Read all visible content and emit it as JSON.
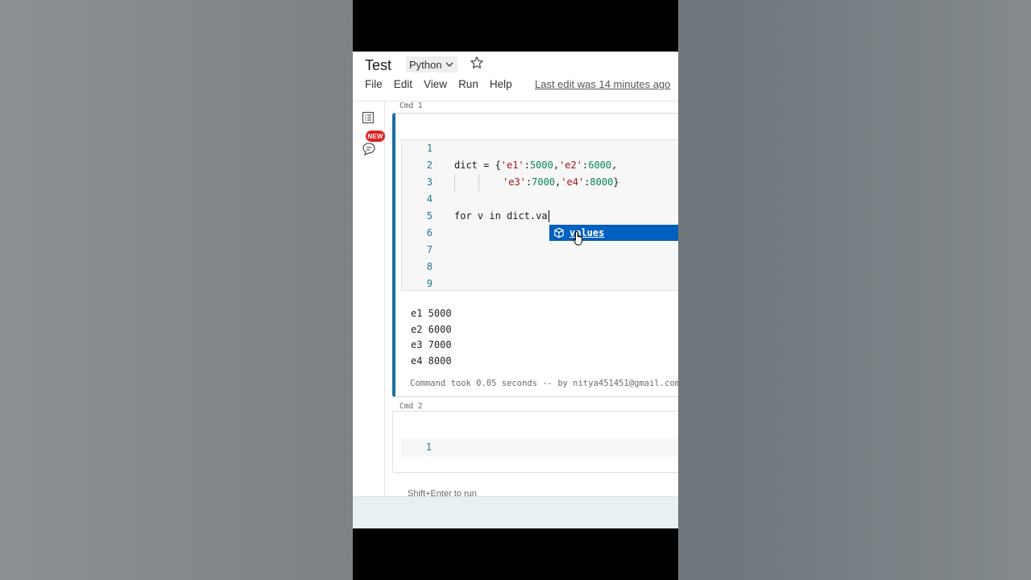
{
  "header": {
    "title": "Test",
    "language": "Python",
    "star_icon": "star-icon",
    "last_edit": "Last edit was 14 minutes ago"
  },
  "menu": {
    "items": [
      "File",
      "Edit",
      "View",
      "Run",
      "Help"
    ]
  },
  "rail": {
    "toc_icon": "table-of-contents-icon",
    "comments_icon": "comments-icon",
    "new_badge": "NEW"
  },
  "cells": [
    {
      "label": "Cmd 1",
      "line_numbers": [
        "1",
        "2",
        "3",
        "4",
        "5",
        "6",
        "7",
        "8",
        "9"
      ],
      "code": {
        "line2_a": "dict = {",
        "line2_s1": "'e1'",
        "line2_c1": ":",
        "line2_n1": "5000",
        "line2_c2": ",",
        "line2_s2": "'e2'",
        "line2_c3": ":",
        "line2_n2": "6000",
        "line2_c4": ",",
        "line3_s1": "'e3'",
        "line3_c1": ":",
        "line3_n1": "7000",
        "line3_c2": ",",
        "line3_s2": "'e4'",
        "line3_c3": ":",
        "line3_n2": "8000",
        "line3_c4": "}",
        "line5": "for v in dict.va"
      },
      "autocomplete": {
        "icon": "cube-icon",
        "suggestion": "values"
      },
      "output": [
        "e1 5000",
        "e2 6000",
        "e3 7000",
        "e4 8000"
      ],
      "status": "Command took 0.05 seconds -- by nitya451451@gmail.com"
    },
    {
      "label": "Cmd 2",
      "line_numbers": [
        "1"
      ]
    }
  ],
  "hint": "Shift+Enter to run",
  "colors": {
    "accent": "#1a6fa0",
    "suggest_bg": "#0060c0",
    "string": "#a31515",
    "number": "#098658",
    "line_number": "#237893",
    "badge": "#e02020"
  }
}
